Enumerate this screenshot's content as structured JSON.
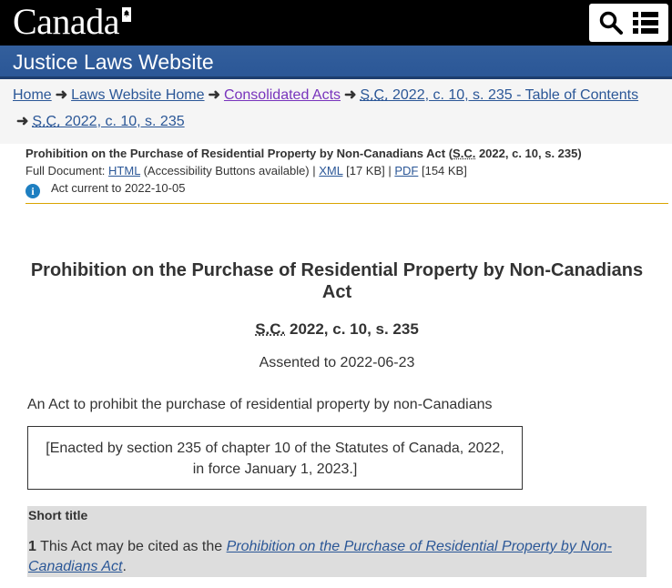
{
  "header": {
    "wordmark": "Canada",
    "site_title": "Justice Laws Website"
  },
  "breadcrumb": {
    "home": "Home",
    "laws_home": "Laws Website Home",
    "consolidated": "Consolidated Acts",
    "toc_abbr": "S.C.",
    "toc_rest": " 2022, c. 10, s. 235 -  Table of Contents",
    "current_abbr": "S.C.",
    "current_rest": " 2022, c. 10, s. 235"
  },
  "docinfo": {
    "title_start": "Prohibition on the Purchase of Residential Property by Non-Canadians Act (",
    "title_abbr": "S.C.",
    "title_end": " 2022, c. 10, s. 235)",
    "full_doc_label": "Full Document: ",
    "html_link": "HTML",
    "html_note": " (Accessibility Buttons available) | ",
    "xml_link": "XML",
    "xml_size": " [17 KB] | ",
    "pdf_link": "PDF",
    "pdf_size": " [154 KB]",
    "current": "Act current to 2022-10-05"
  },
  "act": {
    "title": "Prohibition on the Purchase of Residential Property by Non-Canadians Act",
    "citation_abbr": "S.C.",
    "citation_rest": " 2022, c. 10, s. 235",
    "assented": "Assented to 2022-06-23",
    "long_title": "An Act to prohibit the purchase of residential property by non-Canadians",
    "enacted_line1": "[Enacted by section 235 of chapter 10 of the Statutes of Canada, 2022,",
    "enacted_line2": "in force January 1, 2023.]"
  },
  "section1": {
    "heading": "Short title",
    "number": "1",
    "text_before": " This Act may be cited as the ",
    "link": "Prohibition on the Purchase of Residential Property by Non-Canadians Act",
    "text_after": "."
  }
}
